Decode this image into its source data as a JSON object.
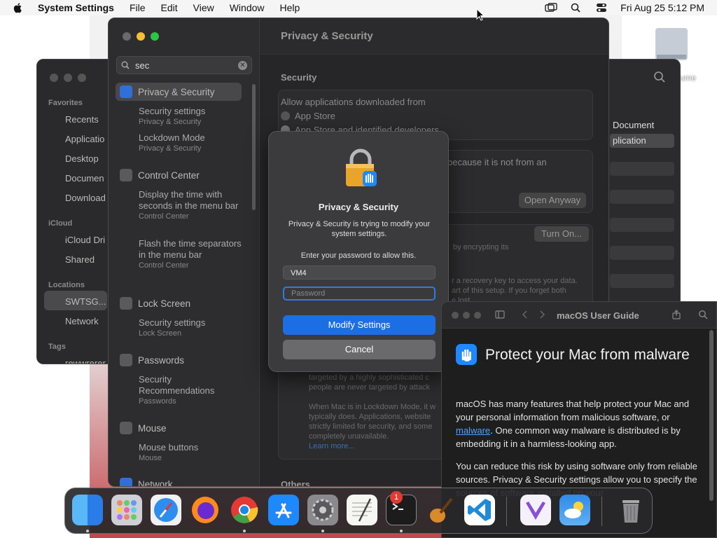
{
  "menubar": {
    "app_name": "System Settings",
    "items": [
      "File",
      "Edit",
      "View",
      "Window",
      "Help"
    ],
    "clock": "Fri Aug 25  5:12 PM"
  },
  "desktop": {
    "disk_label": "lume"
  },
  "finder": {
    "favorites_header": "Favorites",
    "favorites": [
      "Recents",
      "Applicatio",
      "Desktop",
      "Documen",
      "Download"
    ],
    "icloud_header": "iCloud",
    "icloud": [
      "iCloud Dri",
      "Shared"
    ],
    "locations_header": "Locations",
    "locations": [
      "SWTSG...",
      "Network"
    ],
    "tags_header": "Tags",
    "tags_item": "rewwrerer",
    "right_labels": [
      "Document",
      "plication"
    ]
  },
  "settings": {
    "search_value": "sec",
    "sidebar": [
      {
        "group": "Privacy & Security",
        "subs": [
          {
            "title": "Security settings",
            "cap": "Privacy & Security"
          },
          {
            "title": "Lockdown Mode",
            "cap": "Privacy & Security"
          }
        ]
      },
      {
        "group": "Control Center",
        "subs": [
          {
            "title": "Display the time with seconds in the menu bar",
            "cap": "Control Center"
          },
          {
            "title": "Flash the time separators in the menu bar",
            "cap": "Control Center"
          }
        ]
      },
      {
        "group": "Lock Screen",
        "subs": [
          {
            "title": "Security settings",
            "cap": "Lock Screen"
          }
        ]
      },
      {
        "group": "Passwords",
        "subs": [
          {
            "title": "Security Recommendations",
            "cap": "Passwords"
          }
        ]
      },
      {
        "group": "Mouse",
        "subs": [
          {
            "title": "Mouse buttons",
            "cap": "Mouse"
          }
        ]
      },
      {
        "group": "Network",
        "subs": []
      }
    ],
    "main": {
      "title": "Privacy & Security",
      "section_security": "Security",
      "allow_label": "Allow applications downloaded from",
      "radio_app_store": "App Store",
      "radio_app_store_devs": "App Store and identified developers",
      "blocked_text": "because it is not from an",
      "open_anyway": "Open Anyway",
      "turn_on": "Turn On...",
      "encrypting_text": "by encrypting its",
      "recovery_text_1": "r a recovery key to access your data.",
      "recovery_text_2": "art of this setup. If you forget both",
      "recovery_text_3": "e lost.",
      "lockdown_1": "targeted by a highly sophisticated c",
      "lockdown_2": "people are never targeted by attack",
      "lockdown_3": "When Mac is in Lockdown Mode, it w",
      "lockdown_4": "typically does. Applications, website",
      "lockdown_5": "strictly limited for security, and some",
      "lockdown_6": "completely unavailable.",
      "learn_more": "Learn more...",
      "section_others": "Others"
    }
  },
  "dialog": {
    "title": "Privacy & Security",
    "message": "Privacy & Security is trying to modify your system settings.",
    "prompt": "Enter your password to allow this.",
    "username": "VM4",
    "password_placeholder": "Password",
    "primary": "Modify Settings",
    "secondary": "Cancel"
  },
  "guide": {
    "title": "macOS User Guide",
    "heading": "Protect your Mac from malware",
    "para1_a": "macOS has many features that help protect your Mac and your personal information from malicious software, or ",
    "para1_link": "malware",
    "para1_b": ". One common way malware is distributed is by embedding it in a harmless-looking app.",
    "para2": "You can reduce this risk by using software only from reliable sources. Privacy & Security settings allow you to specify the sources of software installed on your"
  },
  "dock": {
    "apps": [
      "finder-icon",
      "launchpad-icon",
      "safari-icon",
      "firefox-icon",
      "chrome-icon",
      "app-store-icon",
      "system-settings-icon",
      "textedit-icon",
      "terminal-icon",
      "instruments-icon",
      "vscode-icon",
      "visual-studio-icon",
      "weather-icon",
      "trash-icon"
    ],
    "settings_badge": "1"
  }
}
